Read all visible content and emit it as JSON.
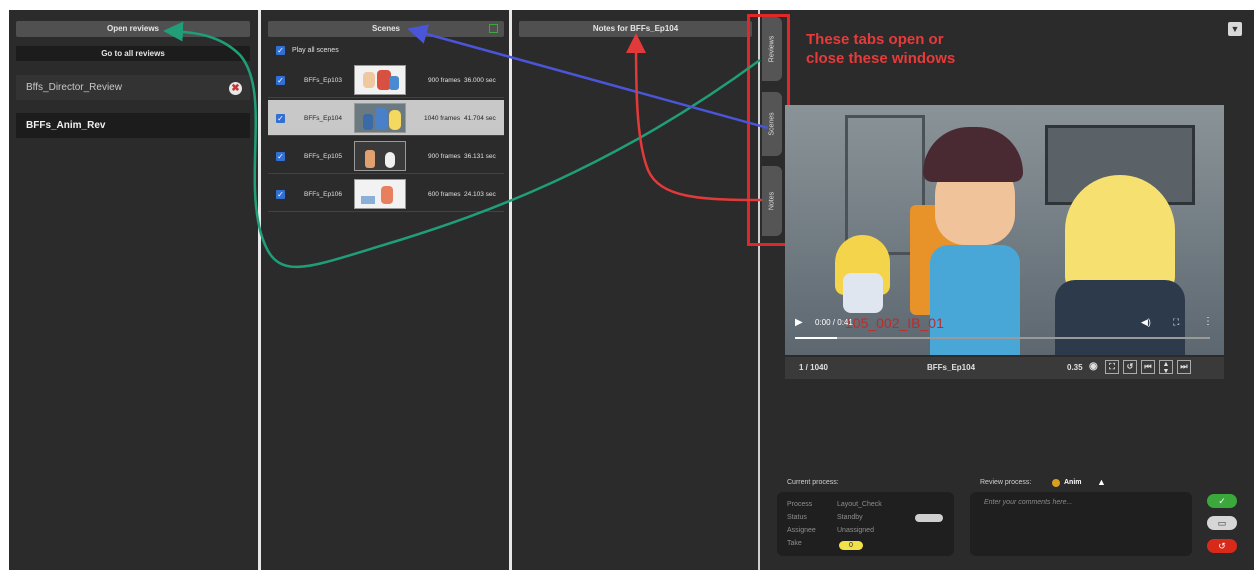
{
  "reviews_panel": {
    "header": "Open reviews",
    "goto_label": "Go to all reviews",
    "items": [
      {
        "name": "Bffs_Director_Review"
      },
      {
        "name": "BFFs_Anim_Rev"
      }
    ]
  },
  "scenes_panel": {
    "header": "Scenes",
    "play_all_label": "Play all scenes",
    "scenes": [
      {
        "name": "BFFs_Ep103",
        "frames": "900 frames",
        "duration": "36.000 sec",
        "checked": true,
        "selected": false
      },
      {
        "name": "BFFs_Ep104",
        "frames": "1040 frames",
        "duration": "41.704 sec",
        "checked": true,
        "selected": true
      },
      {
        "name": "BFFs_Ep105",
        "frames": "900 frames",
        "duration": "36.131 sec",
        "checked": true,
        "selected": false
      },
      {
        "name": "BFFs_Ep106",
        "frames": "600 frames",
        "duration": "24.103 sec",
        "checked": true,
        "selected": false
      }
    ]
  },
  "notes_panel": {
    "header": "Notes for BFFs_Ep104"
  },
  "side_tabs": [
    "Reviews",
    "Scenes",
    "Notes"
  ],
  "annotation": {
    "line1": "These tabs open or",
    "line2": "close these windows"
  },
  "player": {
    "time": "0:00 / 0:41",
    "overlay_text": "105_002_IB_01",
    "frame_counter": "1 / 1040",
    "scene_name": "BFFs_Ep104",
    "speed": "0.35"
  },
  "current_process": {
    "title": "Current process:",
    "labels": [
      "Process",
      "Status",
      "Assignee",
      "Take"
    ],
    "values": [
      "Layout_Check",
      "Standby",
      "Unassigned",
      "0"
    ]
  },
  "review_process": {
    "label": "Review process:",
    "value": "Anim",
    "comment_placeholder": "Enter your comments here..."
  },
  "colors": {
    "teal_arrow": "#1f9e78",
    "blue_arrow": "#4a55d8",
    "red_arrow": "#e23a3a",
    "approve": "#3aa83a",
    "reject": "#d82a1a",
    "checkbox": "#2f6fd6"
  },
  "icons": [
    "calendar-icon",
    "close-icon",
    "dropdown-icon",
    "play-icon",
    "volume-icon",
    "fullscreen-icon",
    "more-icon",
    "eye-icon",
    "check-icon",
    "comment-icon",
    "undo-icon"
  ]
}
